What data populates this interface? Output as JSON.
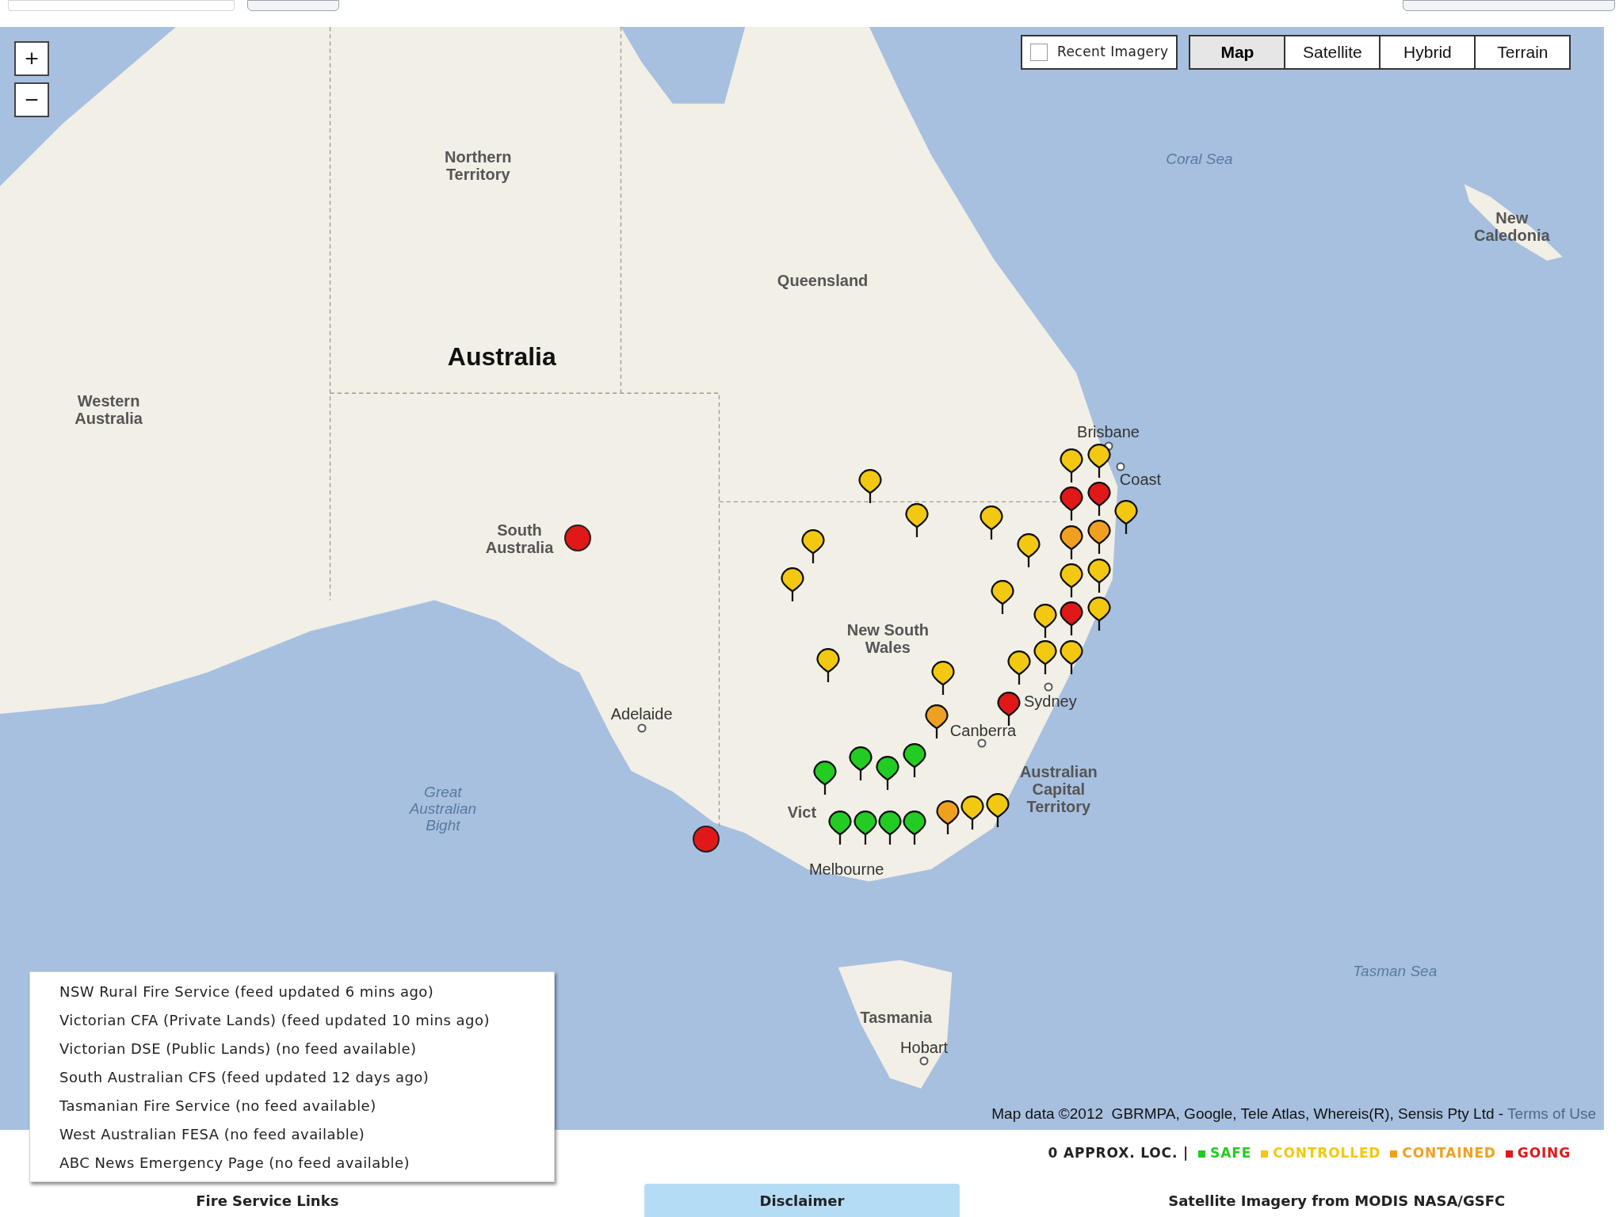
{
  "map_controls": {
    "zoom": [
      "+",
      "−"
    ],
    "recent_imagery": {
      "label": "Recent Imagery",
      "checked": false
    },
    "map_types": [
      {
        "label": "Map",
        "selected": true
      },
      {
        "label": "Satellite",
        "selected": false
      },
      {
        "label": "Hybrid",
        "selected": false
      },
      {
        "label": "Terrain",
        "selected": false
      }
    ]
  },
  "map_labels": [
    {
      "text": "Coral Sea",
      "kind": "sea"
    },
    {
      "text": "New Caledonia",
      "kind": "region"
    },
    {
      "text": "Northern Territory",
      "kind": "region"
    },
    {
      "text": "Queensland",
      "kind": "region"
    },
    {
      "text": "Australia",
      "kind": "country"
    },
    {
      "text": "Western Australia",
      "kind": "region"
    },
    {
      "text": "Brisbane",
      "kind": "city"
    },
    {
      "text": "Coast",
      "kind": "city"
    },
    {
      "text": "South Australia",
      "kind": "region"
    },
    {
      "text": "New South Wales",
      "kind": "region"
    },
    {
      "text": "Sydney",
      "kind": "city"
    },
    {
      "text": "Adelaide",
      "kind": "city"
    },
    {
      "text": "Canberra",
      "kind": "city"
    },
    {
      "text": "Australian Capital Territory",
      "kind": "region"
    },
    {
      "text": "Great Australian Bight",
      "kind": "sea"
    },
    {
      "text": "Vict",
      "kind": "region"
    },
    {
      "text": "Melbourne",
      "kind": "city"
    },
    {
      "text": "Tasman Sea",
      "kind": "sea"
    },
    {
      "text": "Tasmania",
      "kind": "region"
    },
    {
      "text": "Hobart",
      "kind": "city"
    }
  ],
  "markers": [
    {
      "kind": "dot",
      "color": "#e01818"
    },
    {
      "kind": "dot",
      "color": "#e01818"
    },
    {
      "kind": "pin",
      "color": "#f2c811"
    },
    {
      "kind": "pin",
      "color": "#f2c811"
    },
    {
      "kind": "pin",
      "color": "#f2c811"
    },
    {
      "kind": "pin",
      "color": "#f2c811"
    },
    {
      "kind": "pin",
      "color": "#f2c811"
    },
    {
      "kind": "pin",
      "color": "#f2c811"
    },
    {
      "kind": "pin",
      "color": "#f2c811"
    },
    {
      "kind": "pin",
      "color": "#f2c811"
    },
    {
      "kind": "pin",
      "color": "#f2c811"
    },
    {
      "kind": "pin",
      "color": "#f2c811"
    },
    {
      "kind": "pin",
      "color": "#f2c811"
    },
    {
      "kind": "pin",
      "color": "#e01818"
    },
    {
      "kind": "pin",
      "color": "#e01818"
    },
    {
      "kind": "pin",
      "color": "#f0a020"
    },
    {
      "kind": "pin",
      "color": "#f0a020"
    },
    {
      "kind": "pin",
      "color": "#f2c811"
    },
    {
      "kind": "pin",
      "color": "#f2c811"
    },
    {
      "kind": "pin",
      "color": "#e01818"
    },
    {
      "kind": "pin",
      "color": "#f2c811"
    },
    {
      "kind": "pin",
      "color": "#f2c811"
    },
    {
      "kind": "pin",
      "color": "#f2c811"
    },
    {
      "kind": "pin",
      "color": "#f2c811"
    },
    {
      "kind": "pin",
      "color": "#f2c811"
    },
    {
      "kind": "pin",
      "color": "#f2c811"
    },
    {
      "kind": "pin",
      "color": "#e01818"
    },
    {
      "kind": "pin",
      "color": "#f0a020"
    },
    {
      "kind": "pin",
      "color": "#f0a020"
    },
    {
      "kind": "pin",
      "color": "#f2c811"
    },
    {
      "kind": "pin",
      "color": "#f2c811"
    },
    {
      "kind": "pin",
      "color": "#22cc22"
    },
    {
      "kind": "pin",
      "color": "#22cc22"
    },
    {
      "kind": "pin",
      "color": "#22cc22"
    },
    {
      "kind": "pin",
      "color": "#22cc22"
    },
    {
      "kind": "pin",
      "color": "#22cc22"
    },
    {
      "kind": "pin",
      "color": "#22cc22"
    },
    {
      "kind": "pin",
      "color": "#22cc22"
    },
    {
      "kind": "pin",
      "color": "#22cc22"
    }
  ],
  "attribution": {
    "text": "Map data ©2012  GBRMPA, Google, Tele Atlas, Whereis(R), Sensis Pty Ltd - ",
    "link": "Terms of Use"
  },
  "fire_service_links": [
    "NSW Rural Fire Service (feed updated 6 mins ago)",
    "Victorian CFA (Private Lands) (feed updated 10 mins ago)",
    "Victorian DSE (Public Lands) (no feed available)",
    "South Australian CFS (feed updated 12 days ago)",
    "Tasmanian Fire Service (no feed available)",
    "West Australian FESA (no feed available)",
    "ABC News Emergency Page (no feed available)"
  ],
  "legend": {
    "prefix": "0 APPROX. LOC. |",
    "items": [
      {
        "label": "SAFE",
        "color": "#22cc22"
      },
      {
        "label": "CONTROLLED",
        "color": "#f2c811"
      },
      {
        "label": "CONTAINED",
        "color": "#f0a020"
      },
      {
        "label": "GOING",
        "color": "#e01818"
      }
    ]
  },
  "bottom_tabs": [
    {
      "label": "Fire Service Links",
      "selected": false
    },
    {
      "label": "Disclaimer",
      "selected": true
    },
    {
      "label": "Satellite Imagery from MODIS NASA/GSFC",
      "selected": false
    }
  ]
}
